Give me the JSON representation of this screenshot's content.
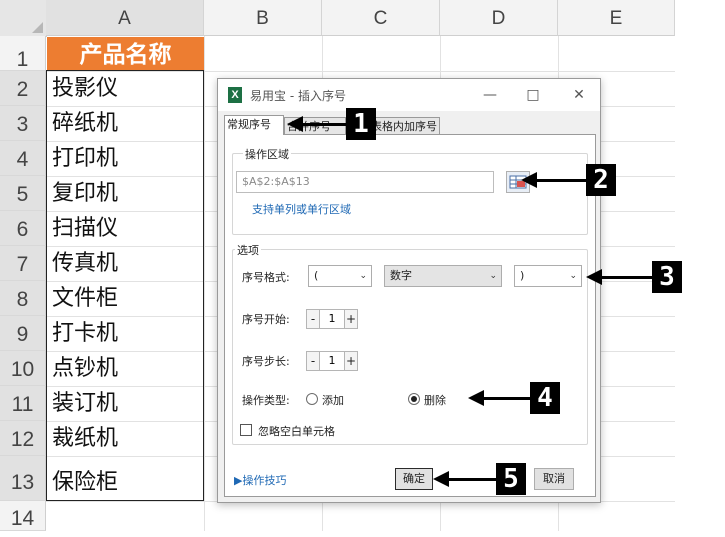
{
  "sheet": {
    "columns": [
      "A",
      "B",
      "C",
      "D",
      "E"
    ],
    "rows": [
      "1",
      "2",
      "3",
      "4",
      "5",
      "6",
      "7",
      "8",
      "9",
      "10",
      "11",
      "12",
      "13",
      "14"
    ],
    "header_cell": "产品名称",
    "cells": [
      "投影仪",
      "碎纸机",
      "打印机",
      "复印机",
      "扫描仪",
      "传真机",
      "文件柜",
      "打卡机",
      "点钞机",
      "装订机",
      "裁纸机",
      "保险柜"
    ],
    "header_color": "#ed7d31"
  },
  "dialog": {
    "icon": "X",
    "title": "易用宝 - 插入序号",
    "tabs": [
      "常规序号",
      "合并序号",
      "表格内加序号"
    ],
    "area_group": "操作区域",
    "range_value": "$A$2:$A$13",
    "support_link": "支持单列或单行区域",
    "options_group": "选项",
    "format_label": "序号格式:",
    "format_prefix": "(",
    "format_type": "数字",
    "format_suffix": ")",
    "start_label": "序号开始:",
    "start_value": "1",
    "step_label": "序号步长:",
    "step_value": "1",
    "optype_label": "操作类型:",
    "add_label": "添加",
    "delete_label": "删除",
    "selected_op": "delete",
    "ignore_label": "忽略空白单元格",
    "tips_link": "▶操作技巧",
    "ok_label": "确定",
    "cancel_label": "取消",
    "minus": "-",
    "plus": "+"
  },
  "callouts": [
    "1",
    "2",
    "3",
    "4",
    "5"
  ]
}
